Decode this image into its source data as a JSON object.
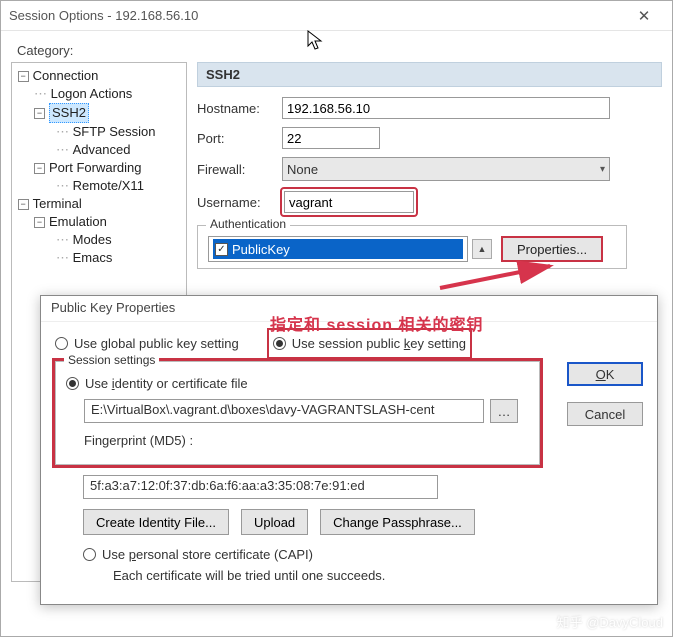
{
  "window": {
    "title": "Session Options - 192.168.56.10",
    "category_label": "Category:"
  },
  "tree": {
    "connection": "Connection",
    "logon": "Logon Actions",
    "ssh2": "SSH2",
    "sftp": "SFTP Session",
    "advanced": "Advanced",
    "portfwd": "Port Forwarding",
    "remotex11": "Remote/X11",
    "terminal": "Terminal",
    "emulation": "Emulation",
    "modes": "Modes",
    "emacs": "Emacs"
  },
  "form": {
    "section": "SSH2",
    "hostname_label": "Hostname:",
    "hostname_value": "192.168.56.10",
    "port_label": "Port:",
    "port_value": "22",
    "firewall_label": "Firewall:",
    "firewall_value": "None",
    "username_label": "Username:",
    "username_value": "vagrant",
    "auth_legend": "Authentication",
    "auth_item": "PublicKey",
    "properties_btn": "Properties..."
  },
  "annotation": "指定和 session 相关的密钥",
  "modal": {
    "title": "Public Key Properties",
    "radio_global": "Use global public key setting",
    "radio_session": "Use session public key setting",
    "session_legend": "Session settings",
    "radio_identity": "Use identity or certificate file",
    "path_value": "E:\\VirtualBox\\.vagrant.d\\boxes\\davy-VAGRANTSLASH-cent",
    "fingerprint_label": "Fingerprint (MD5) :",
    "fingerprint_value": "5f:a3:a7:12:0f:37:db:6a:f6:aa:a3:35:08:7e:91:ed",
    "create_btn": "Create Identity File...",
    "upload_btn": "Upload",
    "change_btn": "Change Passphrase...",
    "radio_capi": "Use personal store certificate (CAPI)",
    "capi_note": "Each certificate will be tried until one succeeds.",
    "ok": "OK",
    "cancel": "Cancel"
  },
  "watermark": "知乎 @DavyCloud"
}
